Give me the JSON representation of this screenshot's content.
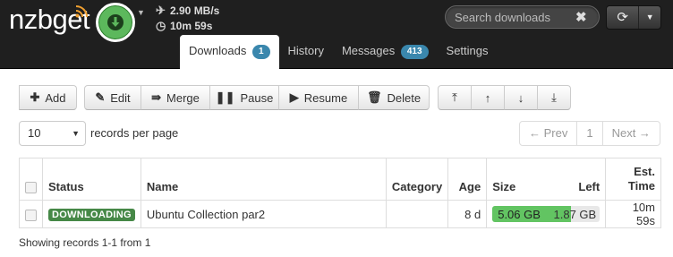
{
  "app": {
    "logo": "nzbget",
    "download_rate": "2.90 MB/s",
    "time_left": "10m 59s"
  },
  "search": {
    "placeholder": "Search downloads"
  },
  "tabs": [
    {
      "label": "Downloads",
      "badge": "1"
    },
    {
      "label": "History"
    },
    {
      "label": "Messages",
      "badge": "413"
    },
    {
      "label": "Settings"
    }
  ],
  "toolbar": {
    "add": "Add",
    "edit": "Edit",
    "merge": "Merge",
    "pause": "Pause",
    "resume": "Resume",
    "delete": "Delete"
  },
  "paging": {
    "page_size": "10",
    "records_per_page": "records per page",
    "prev": "← Prev",
    "page": "1",
    "next": "Next →"
  },
  "table": {
    "headers": {
      "status": "Status",
      "name": "Name",
      "category": "Category",
      "age": "Age",
      "size": "Size",
      "left": "Left",
      "est_time_1": "Est.",
      "est_time_2": "Time"
    },
    "rows": [
      {
        "status": "DOWNLOADING",
        "name": "Ubuntu Collection par2",
        "category": "",
        "age": "8 d",
        "size": "5.06 GB",
        "left": "1.87 GB",
        "progress_fraction": 0.73,
        "est_time": "10m 59s"
      }
    ]
  },
  "footer": {
    "records_info": "Showing records 1-1 from 1"
  },
  "colors": {
    "navbar": "#1f1f1f",
    "download_button": "#5cb85c",
    "badge": "#3a87ad",
    "status_downloading": "#468847",
    "progress_fill": "#62c462"
  }
}
